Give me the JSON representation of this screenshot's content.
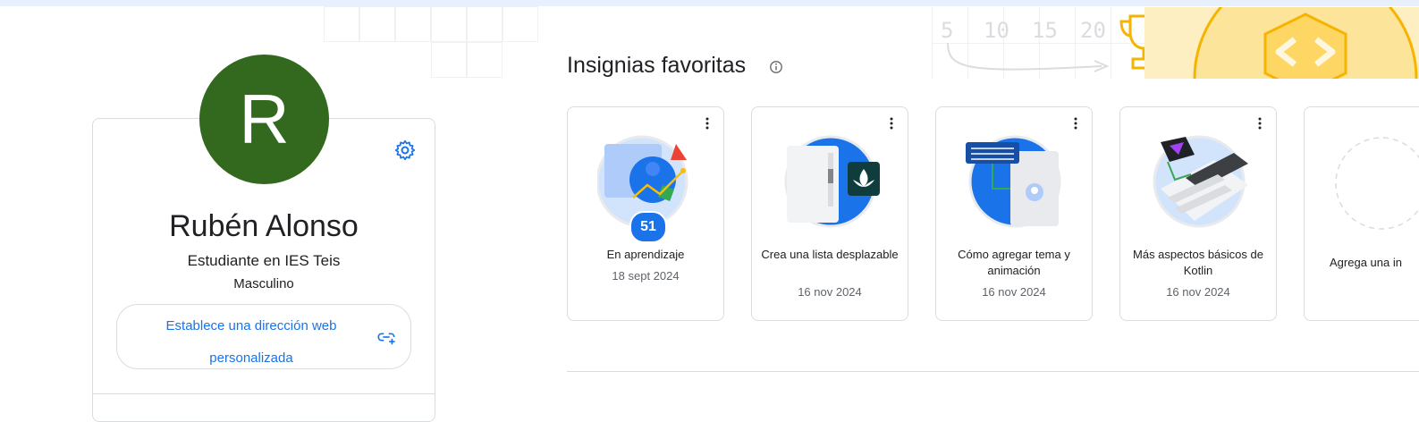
{
  "profile": {
    "initial": "R",
    "name": "Rubén Alonso",
    "subtitle": "Estudiante en IES Teis",
    "gender": "Masculino",
    "custom_url_label": "Establece una dirección web personalizada",
    "avatar_color": "#33691e"
  },
  "badges": {
    "title": "Insignias favoritas",
    "items": [
      {
        "title": "En aprendizaje",
        "date": "18 sept 2024",
        "count": "51"
      },
      {
        "title": "Crea una lista desplazable",
        "date": "16 nov 2024"
      },
      {
        "title": "Cómo agregar tema y animación",
        "date": "16 nov 2024"
      },
      {
        "title": "Más aspectos básicos de Kotlin",
        "date": "16 nov 2024"
      },
      {
        "title": "Agrega una in"
      }
    ]
  },
  "decor": {
    "numbers": [
      "5",
      "10",
      "15",
      "20"
    ]
  },
  "colors": {
    "accent": "#1a73e8",
    "border": "#dadce0",
    "banner": "#fdefc2"
  }
}
